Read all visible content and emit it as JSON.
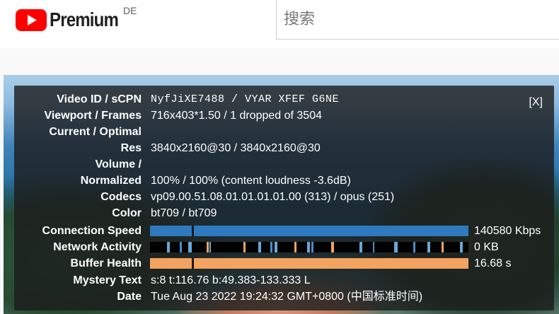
{
  "header": {
    "brand": "Premium",
    "country": "DE",
    "search_placeholder": "搜索",
    "logo_color": "#ff0000"
  },
  "stats": {
    "close_label": "[X]",
    "rows": [
      {
        "label": "Video ID / sCPN",
        "value": "NyfJiXE7488 / VYAR XFEF G6NE"
      },
      {
        "label": "Viewport / Frames",
        "value": "716x403*1.50 / 1 dropped of 3504"
      },
      {
        "label": "Current / Optimal",
        "value": ""
      },
      {
        "label": "Res",
        "value": "3840x2160@30 / 3840x2160@30"
      },
      {
        "label": "Volume /",
        "value": ""
      },
      {
        "label": "Normalized",
        "value": "100% / 100% (content loudness -3.6dB)"
      },
      {
        "label": "Codecs",
        "value": "vp09.00.51.08.01.01.01.01.00 (313) / opus (251)"
      },
      {
        "label": "Color",
        "value": "bt709 / bt709"
      }
    ],
    "connection_speed": {
      "label": "Connection Speed",
      "value": "140580 Kbps",
      "color": "#2f79bf"
    },
    "network_activity": {
      "label": "Network Activity",
      "value": "0 KB"
    },
    "buffer_health": {
      "label": "Buffer Health",
      "value": "16.68 s",
      "color": "#f3a35f"
    },
    "mystery_text": {
      "label": "Mystery Text",
      "value": "s:8 t:116.76 b:49.383-133.333 L"
    },
    "date": {
      "label": "Date",
      "value": "Tue Aug 23 2022 19:24:32 GMT+0800 (中国标准时间)"
    }
  }
}
